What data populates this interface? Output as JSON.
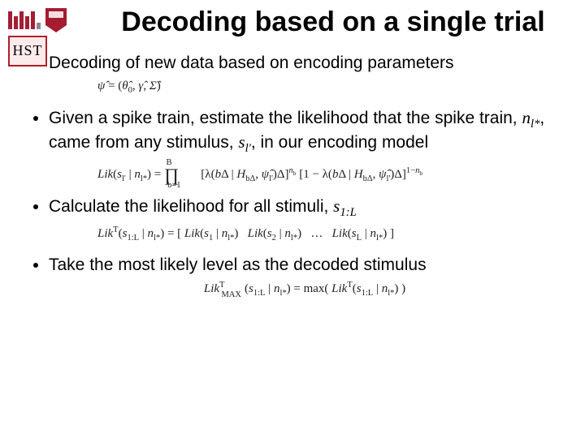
{
  "logos": {
    "mit_name": "mit-logo",
    "harvard_name": "harvard-shield",
    "hst_label": "HST"
  },
  "title": "Decoding based on a single trial",
  "bullets": {
    "b1": "Decoding of new data based on encoding parameters",
    "eq1": "ψ̂ = (θ̂₀, γ̂, Σ̂)",
    "b2_pre": " Given a spike train, estimate the likelihood that the spike train, ",
    "b2_nl": "n",
    "b2_nlsub": "l*",
    "b2_mid": ", came from any stimulus, ",
    "b2_sl": "s",
    "b2_slsub": "l'",
    "b2_post": ", in our encoding model",
    "eq2": "Lik(s_{l'} | n_{l*}) = ∏_{b=1}^{B} [λ(bΔ | H_{bΔ}, ψ̂_{l'}) Δ]^{n_b} [1 − λ(bΔ | H_{bΔ}, ψ̂_{l'}) Δ]^{1−n_b}",
    "b3_pre": "Calculate the likelihood for all stimuli, ",
    "b3_s": "s",
    "b3_ssub": "1:L",
    "eq3": "Likᵀ(s_{1:L} | n_{l*}) = [ Lik(s₁ | n_{l*})   Lik(s₂ | n_{l*})   …   Lik(s_L | n_{l*}) ]",
    "b4": "Take the most likely level as the decoded stimulus",
    "eq4": "Likᵀ_{MAX}(s_{1:L} | n_{l*}) = max( Likᵀ(s_{1:L} | n_{l*}) )"
  }
}
